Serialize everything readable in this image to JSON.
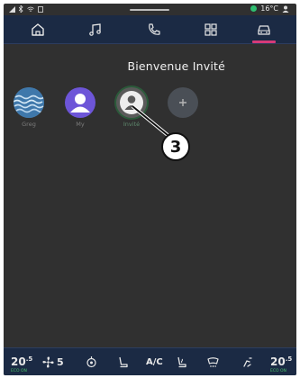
{
  "status_bar": {
    "temperature": "16°C"
  },
  "nav": {
    "items": [
      {
        "icon": "home-icon"
      },
      {
        "icon": "music-icon"
      },
      {
        "icon": "phone-icon"
      },
      {
        "icon": "apps-grid-icon"
      },
      {
        "icon": "car-icon",
        "active": true
      }
    ],
    "accent_color": "#d63a78",
    "background_color": "#1b2a44"
  },
  "main": {
    "title": "Bienvenue Invité",
    "profiles": [
      {
        "label": "Greg",
        "icon": "sea-waves-avatar-icon",
        "color": "#4f86b8"
      },
      {
        "label": "My",
        "icon": "person-avatar-icon",
        "color": "#6d55d8"
      },
      {
        "label": "Invité",
        "icon": "guest-avatar-icon",
        "color": "#5a5a5a",
        "selected": true
      },
      {
        "label": "",
        "icon": "add-profile-icon",
        "color": "#4a4f56"
      }
    ],
    "callout": "3"
  },
  "bottom_bar": {
    "left_temp_main": "20",
    "left_temp_decimal": ".5",
    "left_temp_sub": "ECO ON",
    "fan_speed": "5",
    "ac_label": "A/C",
    "right_temp_main": "20",
    "right_temp_decimal": ".5",
    "right_temp_sub": "ECO ON"
  }
}
